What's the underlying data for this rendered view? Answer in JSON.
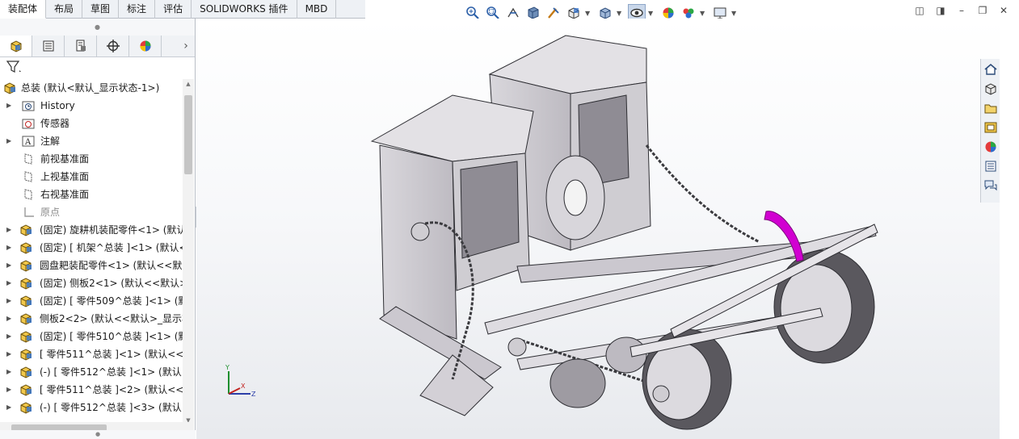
{
  "tabs": [
    "装配体",
    "布局",
    "草图",
    "标注",
    "评估",
    "SOLIDWORKS 插件",
    "MBD"
  ],
  "active_tab": "装配体",
  "hud_icons": [
    "zoom-to-fit-icon",
    "zoom-area-icon",
    "previous-view-icon",
    "section-view-icon",
    "dynamic-annotation-icon",
    "view-orientation-icon",
    "display-style-icon",
    "hide-show-items-icon",
    "edit-appearance-icon",
    "apply-scene-icon",
    "view-settings-icon"
  ],
  "feature_manager_tabs": [
    "featuremanager-tree-icon",
    "propertymanager-icon",
    "configurationmanager-icon",
    "dimxpertmanager-icon",
    "displaymanager-icon"
  ],
  "tree": {
    "root": "总装  (默认<默认_显示状态-1>)",
    "items": [
      {
        "label": "History",
        "icon": "history-folder-icon",
        "expandable": true
      },
      {
        "label": "传感器",
        "icon": "sensor-icon",
        "expandable": false
      },
      {
        "label": "注解",
        "icon": "annotations-icon",
        "expandable": true
      },
      {
        "label": "前视基准面",
        "icon": "plane-icon",
        "expandable": false
      },
      {
        "label": "上视基准面",
        "icon": "plane-icon",
        "expandable": false
      },
      {
        "label": "右视基准面",
        "icon": "plane-icon",
        "expandable": false
      },
      {
        "label": "原点",
        "icon": "origin-icon",
        "expandable": false,
        "gray": true
      },
      {
        "label": "(固定) 旋耕机装配零件<1> (默认<",
        "icon": "subassembly-icon",
        "expandable": true
      },
      {
        "label": "(固定) [ 机架^总装 ]<1> (默认<<",
        "icon": "subassembly-icon",
        "expandable": true
      },
      {
        "label": "圆盘耙装配零件<1> (默认<<默认",
        "icon": "subassembly-icon",
        "expandable": true
      },
      {
        "label": "(固定) 侧板2<1> (默认<<默认>",
        "icon": "subassembly-icon",
        "expandable": true
      },
      {
        "label": "(固定) [ 零件509^总装 ]<1> (默",
        "icon": "subassembly-icon",
        "expandable": true
      },
      {
        "label": "侧板2<2> (默认<<默认>_显示状",
        "icon": "subassembly-icon",
        "expandable": true
      },
      {
        "label": "(固定) [ 零件510^总装 ]<1> (默",
        "icon": "subassembly-icon",
        "expandable": true
      },
      {
        "label": "[ 零件511^总装 ]<1> (默认<<默",
        "icon": "subassembly-icon",
        "expandable": true
      },
      {
        "label": "(-) [ 零件512^总装 ]<1> (默认<",
        "icon": "subassembly-icon",
        "expandable": true
      },
      {
        "label": "[ 零件511^总装 ]<2> (默认<<默",
        "icon": "subassembly-icon",
        "expandable": true
      },
      {
        "label": "(-) [ 零件512^总装 ]<3> (默认<",
        "icon": "subassembly-icon",
        "expandable": true
      }
    ]
  },
  "triad": {
    "x": "X",
    "y": "Y",
    "z": "Z"
  },
  "task_pane_icons": [
    "home-icon",
    "design-library-icon",
    "file-explorer-icon",
    "view-palette-icon",
    "appearances-icon",
    "custom-properties-icon",
    "forum-icon"
  ],
  "colors": {
    "selection_magenta": "#d100d1",
    "model_gray": "#c9c6cc",
    "tab_bg": "#eef1f5"
  }
}
